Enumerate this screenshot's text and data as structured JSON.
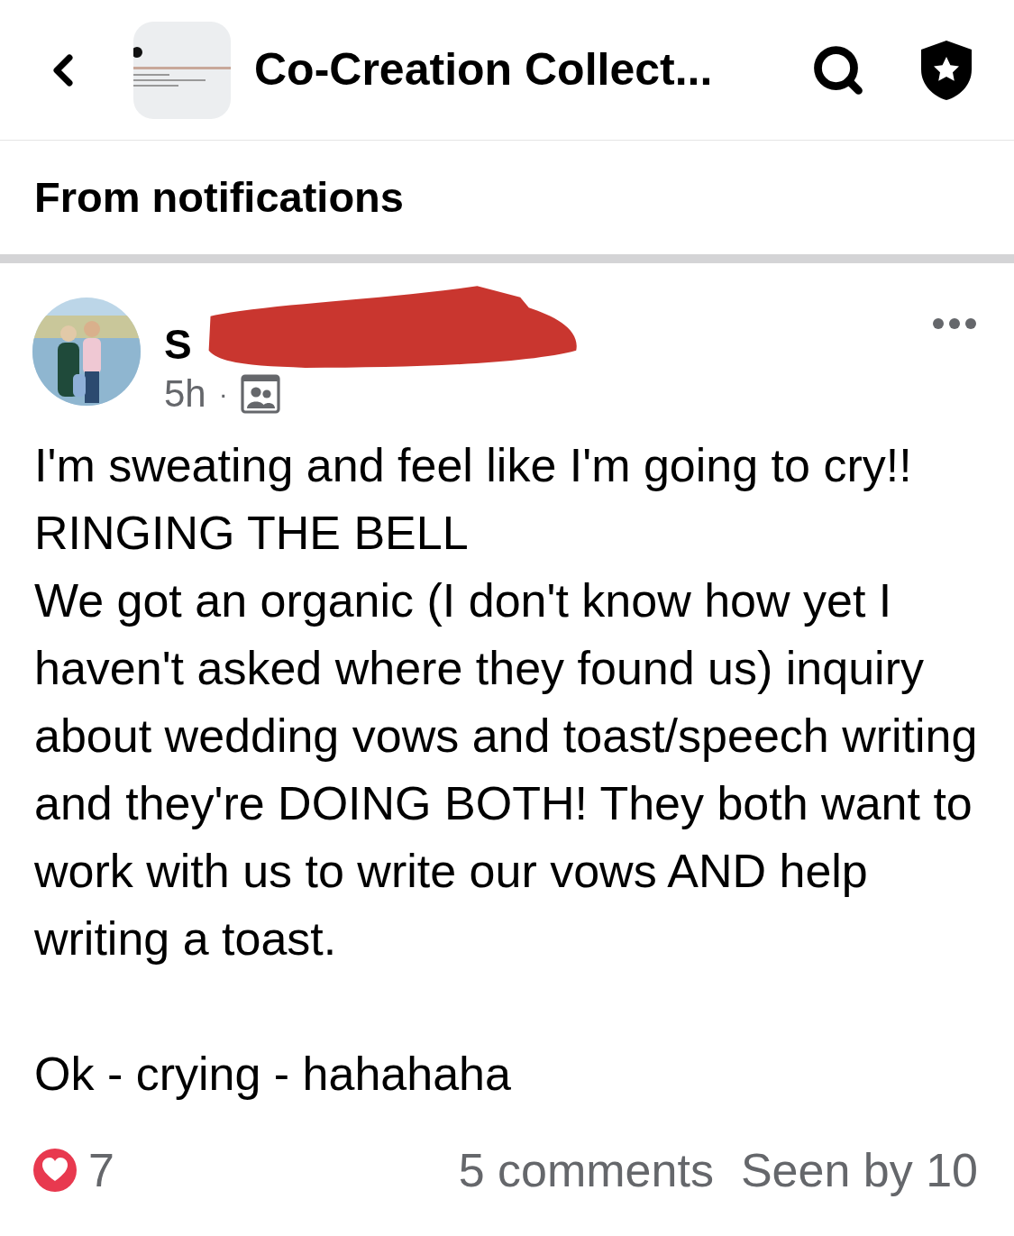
{
  "header": {
    "title": "Co-Creation Collect..."
  },
  "section_title": "From notifications",
  "post": {
    "author": "S",
    "time": "5h",
    "separator": "·",
    "paragraphs": [
      "I'm sweating and feel like I'm going to cry!!",
      "RINGING THE BELL",
      "We got an organic (I don't know how yet I haven't asked where they found us) inquiry about wedding vows and toast/speech writing and they're DOING BOTH! They both want to work with us to write our vows AND help writing a toast.",
      "Ok - crying - hahahaha"
    ],
    "reaction_count": "7",
    "comments": "5 comments",
    "seen": "Seen by 10"
  }
}
